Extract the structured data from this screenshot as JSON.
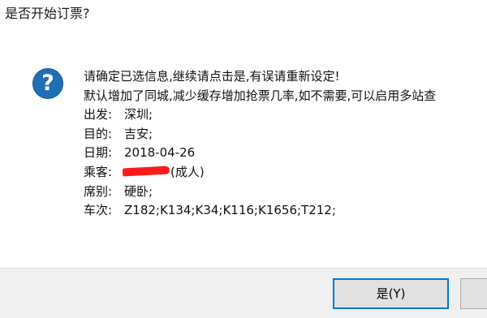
{
  "dialog": {
    "title": "是否开始订票?",
    "lines": {
      "line1": "请确定已选信息,继续请点击是,有误请重新设定!",
      "line2": "默认增加了同城,减少缓存增加抢票几率,如不需要,可以启用多站查",
      "from_label": "出发:",
      "from_value": "深圳;",
      "to_label": "目的:",
      "to_value": "吉安;",
      "date_label": "日期:",
      "date_value": "2018-04-26",
      "passenger_label": "乘客:",
      "passenger_suffix": "(成人)",
      "seat_label": "席别:",
      "seat_value": "硬卧;",
      "train_label": "车次:",
      "train_value": "Z182;K134;K34;K116;K1656;T212;"
    },
    "buttons": {
      "yes": "是(Y)",
      "no": ""
    }
  },
  "icons": {
    "question": "?"
  },
  "colors": {
    "icon_blue": "#1f6fb5",
    "button_focus": "#0078d7",
    "redaction": "#ff1a1a"
  }
}
